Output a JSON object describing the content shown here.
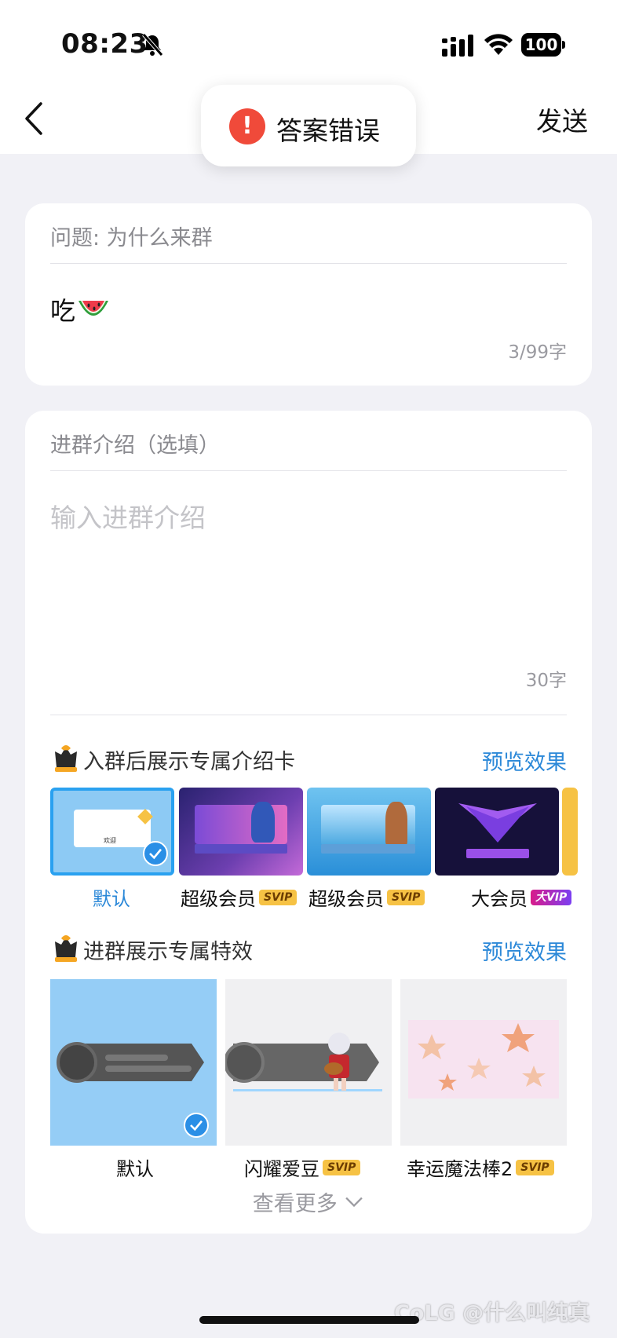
{
  "status": {
    "time": "08:23",
    "battery": "100"
  },
  "nav": {
    "send_label": "发送"
  },
  "toast": {
    "text": "答案错误"
  },
  "question": {
    "label": "问题: 为什么来群",
    "answer": "吃",
    "count": "3/99字"
  },
  "intro": {
    "label": "进群介绍（选填）",
    "placeholder": "输入进群介绍",
    "count": "30字"
  },
  "card_section": {
    "title": "入群后展示专属介绍卡",
    "preview": "预览效果",
    "items": [
      {
        "label": "默认",
        "badge": "",
        "selected": true
      },
      {
        "label": "超级会员",
        "badge": "SVIP"
      },
      {
        "label": "超级会员",
        "badge": "SVIP"
      },
      {
        "label": "大会员",
        "badge": "大VIP"
      }
    ],
    "welcome": "欢迎"
  },
  "effect_section": {
    "title": "进群展示专属特效",
    "preview": "预览效果",
    "items": [
      {
        "label": "默认",
        "badge": "",
        "selected": true
      },
      {
        "label": "闪耀爱豆",
        "badge": "SVIP"
      },
      {
        "label": "幸运魔法棒2",
        "badge": "SVIP"
      }
    ],
    "more": "查看更多"
  },
  "watermark": "CoLG @什么叫纯真",
  "colors": {
    "accent": "#2b88d8",
    "error": "#f04a3a",
    "svip": "#f6c244"
  }
}
